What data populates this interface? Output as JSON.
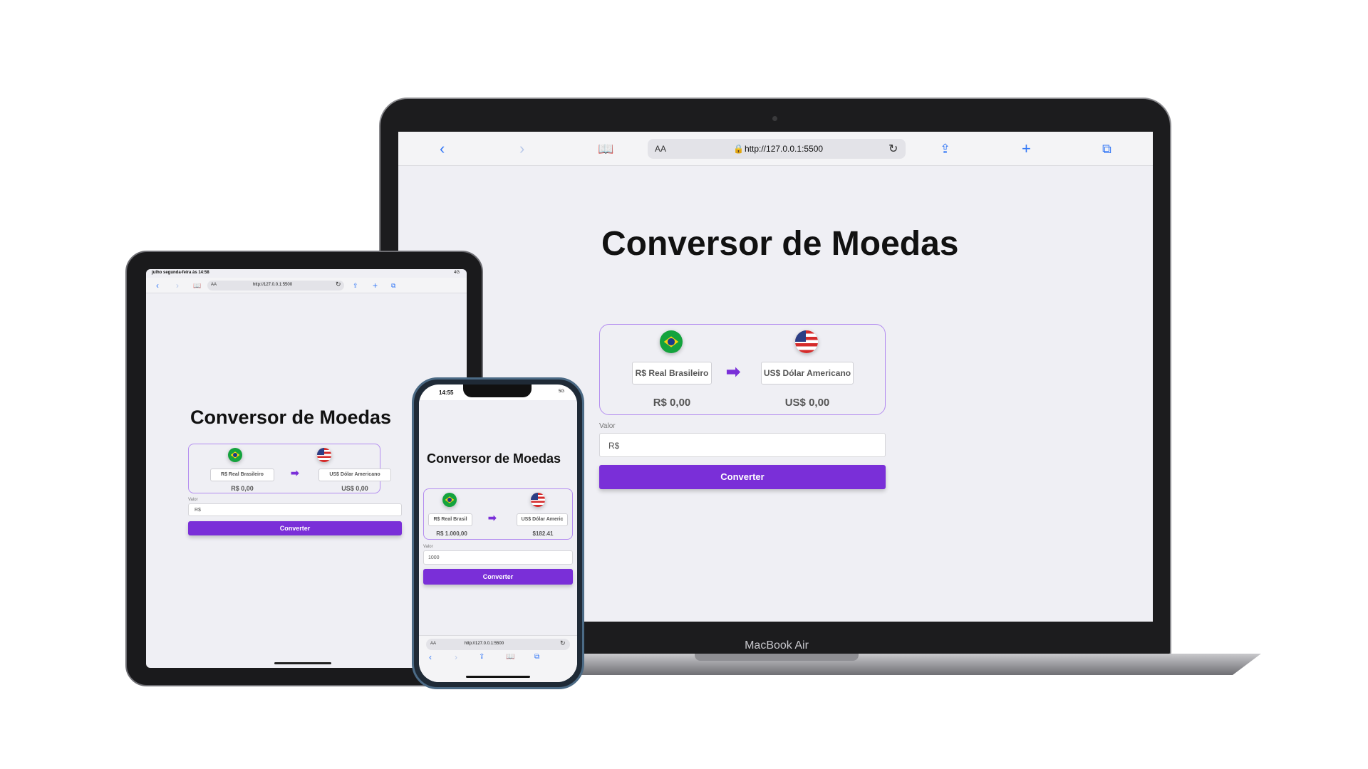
{
  "app": {
    "title": "Conversor de Moedas",
    "from_currency": "R$ Real Brasileiro",
    "to_currency": "US$ Dólar Americano",
    "from_amount": "R$ 0,00",
    "to_amount": "US$ 0,00",
    "value_label": "Valor",
    "value_placeholder": "R$",
    "convert_button": "Converter",
    "arrow": "➡"
  },
  "browser": {
    "url": "http://127.0.0.1:5500",
    "text_size": "AA"
  },
  "laptop": {
    "label": "MacBook Air"
  },
  "tablet": {
    "status_left": "julho segunda-feira às 14:58",
    "status_right": "4G"
  },
  "phone": {
    "time": "14:55",
    "status_right": "5G",
    "from_currency": "R$ Real Brasil",
    "to_currency": "US$ Dólar Americ",
    "from_amount": "R$ 1.000,00",
    "to_amount": "$182.41",
    "input_value": "1000"
  },
  "colors": {
    "accent": "#7a2fd8",
    "card_border": "#b38cf0",
    "safari_blue": "#3478f6",
    "screen_bg": "#efeff4"
  },
  "icons": [
    "back-icon",
    "forward-icon",
    "bookmarks-icon",
    "lock-icon",
    "reload-icon",
    "share-icon",
    "new-tab-icon",
    "tabs-icon",
    "brazil-flag-icon",
    "usa-flag-icon",
    "arrow-right-icon"
  ]
}
